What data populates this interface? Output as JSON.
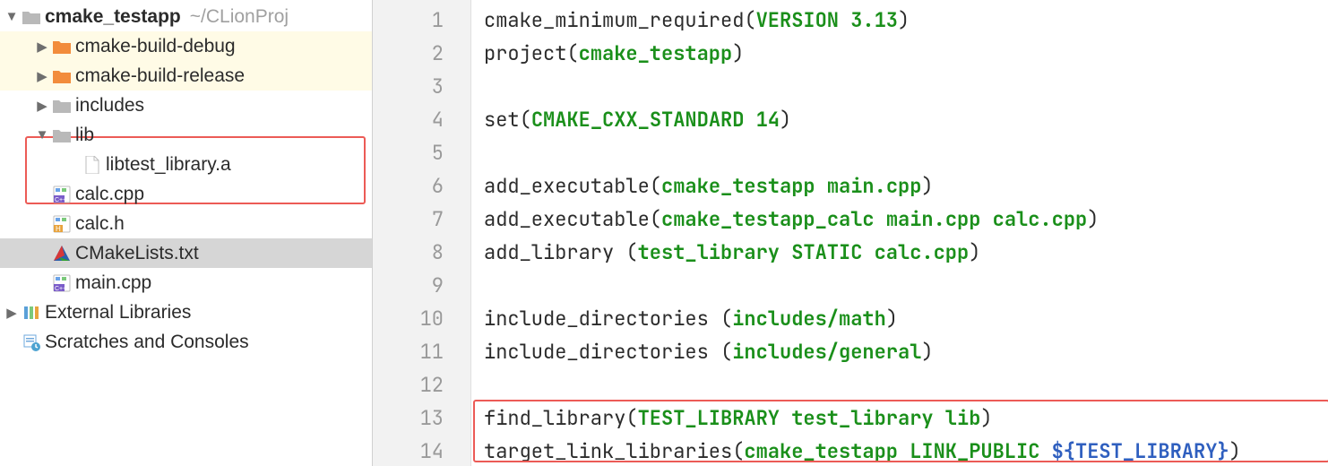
{
  "tree": {
    "root_name": "cmake_testapp",
    "root_path_hint": "~/CLionProj",
    "build_debug": "cmake-build-debug",
    "build_release": "cmake-build-release",
    "includes": "includes",
    "lib": "lib",
    "libfile": "libtest_library.a",
    "calc_cpp": "calc.cpp",
    "calc_h": "calc.h",
    "cmakelists": "CMakeLists.txt",
    "main_cpp": "main.cpp",
    "external_libs": "External Libraries",
    "scratches": "Scratches and Consoles"
  },
  "code": {
    "l1_a": "cmake_minimum_required(",
    "l1_b": "VERSION 3.13",
    "l1_c": ")",
    "l2_a": "project(",
    "l2_b": "cmake_testapp",
    "l2_c": ")",
    "l4_a": "set(",
    "l4_b": "CMAKE_CXX_STANDARD 14",
    "l4_c": ")",
    "l6_a": "add_executable(",
    "l6_b": "cmake_testapp main.cpp",
    "l6_c": ")",
    "l7_a": "add_executable(",
    "l7_b": "cmake_testapp_calc main.cpp calc.cpp",
    "l7_c": ")",
    "l8_a": "add_library (",
    "l8_b": "test_library STATIC calc.cpp",
    "l8_c": ")",
    "l10_a": "include_directories (",
    "l10_b": "includes/math",
    "l10_c": ")",
    "l11_a": "include_directories (",
    "l11_b": "includes/general",
    "l11_c": ")",
    "l13_a": "find_library(",
    "l13_b": "TEST_LIBRARY test_library lib",
    "l13_c": ")",
    "l14_a": "target_link_libraries(",
    "l14_b": "cmake_testapp LINK_PUBLIC ",
    "l14_v": "${TEST_LIBRARY}",
    "l14_c": ")"
  },
  "line_numbers": [
    "1",
    "2",
    "3",
    "4",
    "5",
    "6",
    "7",
    "8",
    "9",
    "10",
    "11",
    "12",
    "13",
    "14"
  ]
}
